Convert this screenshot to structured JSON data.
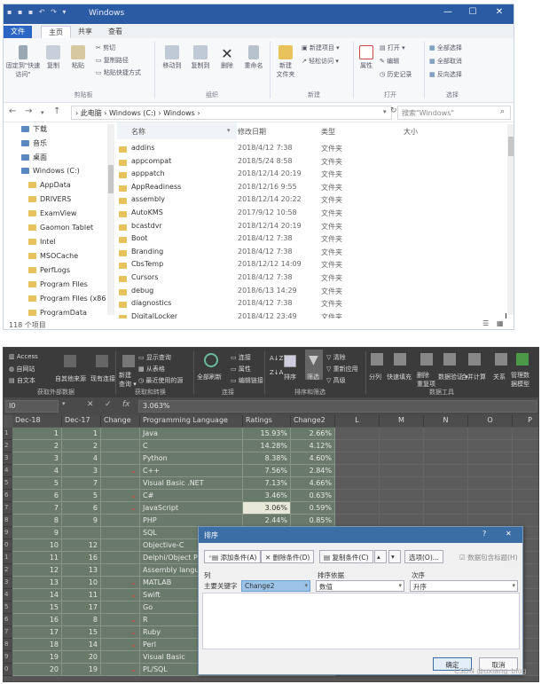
{
  "explorer": {
    "title": "Windows",
    "window_buttons": [
      "—",
      "☐",
      "✕"
    ],
    "tabs": [
      {
        "label": "文件",
        "type": "file"
      },
      {
        "label": "主页",
        "type": "active"
      },
      {
        "label": "共享",
        "type": "normal"
      },
      {
        "label": "查看",
        "type": "normal"
      }
    ],
    "ribbon": {
      "pin_label": "固定到\"快速访问\"",
      "copy_label": "复制",
      "paste_label": "粘贴",
      "cut_label": "剪切",
      "copy_path_label": "复制路径",
      "paste_shortcut_label": "粘贴快捷方式",
      "clipboard_group": "剪贴板",
      "move_to_label": "移动到",
      "copy_to_label": "复制到",
      "delete_label": "删除",
      "rename_label": "重命名",
      "organize_group": "组织",
      "new_item_label": "新建项目 ▾",
      "easy_access_label": "轻松访问 ▾",
      "new_folder_label": "新建\n文件夹",
      "new_group": "新建",
      "properties_label": "属性",
      "open_label": "打开 ▾",
      "edit_label": "编辑",
      "history_label": "历史记录",
      "open_group": "打开",
      "select_all_label": "全部选择",
      "select_none_label": "全部取消",
      "invert_label": "反向选择",
      "select_group": "选择"
    },
    "address": {
      "path": "›  此电脑  ›  Windows (C:)  ›  Windows  ›",
      "search_placeholder": "搜索\"Windows\""
    },
    "nav": [
      {
        "label": "下载",
        "indent": 0
      },
      {
        "label": "音乐",
        "indent": 0
      },
      {
        "label": "桌面",
        "indent": 0
      },
      {
        "label": "Windows (C:)",
        "indent": 0
      },
      {
        "label": "AppData",
        "indent": 1
      },
      {
        "label": "DRIVERS",
        "indent": 1
      },
      {
        "label": "ExamView",
        "indent": 1
      },
      {
        "label": "Gaomon Tablet",
        "indent": 1
      },
      {
        "label": "Intel",
        "indent": 1
      },
      {
        "label": "MSOCache",
        "indent": 1
      },
      {
        "label": "PerfLogs",
        "indent": 1
      },
      {
        "label": "Program Files",
        "indent": 1
      },
      {
        "label": "Program Files (x86",
        "indent": 1
      },
      {
        "label": "ProgramData",
        "indent": 1
      }
    ],
    "columns": {
      "name": "名称",
      "date": "修改日期",
      "type": "类型",
      "size": "大小"
    },
    "files": [
      {
        "name": "addins",
        "date": "2018/4/12 7:38",
        "type": "文件夹"
      },
      {
        "name": "appcompat",
        "date": "2018/5/24 8:58",
        "type": "文件夹"
      },
      {
        "name": "apppatch",
        "date": "2018/12/14 20:19",
        "type": "文件夹"
      },
      {
        "name": "AppReadiness",
        "date": "2018/12/16 9:55",
        "type": "文件夹"
      },
      {
        "name": "assembly",
        "date": "2018/12/14 20:22",
        "type": "文件夹"
      },
      {
        "name": "AutoKMS",
        "date": "2017/9/12 10:58",
        "type": "文件夹"
      },
      {
        "name": "bcastdvr",
        "date": "2018/12/14 20:19",
        "type": "文件夹"
      },
      {
        "name": "Boot",
        "date": "2018/4/12 7:38",
        "type": "文件夹"
      },
      {
        "name": "Branding",
        "date": "2018/4/12 7:38",
        "type": "文件夹"
      },
      {
        "name": "CbsTemp",
        "date": "2018/12/12 14:09",
        "type": "文件夹"
      },
      {
        "name": "Cursors",
        "date": "2018/4/12 7:38",
        "type": "文件夹"
      },
      {
        "name": "debug",
        "date": "2018/6/13 14:29",
        "type": "文件夹"
      },
      {
        "name": "diagnostics",
        "date": "2018/4/12 7:38",
        "type": "文件夹"
      },
      {
        "name": "DigitalLocker",
        "date": "2018/4/12 23:49",
        "type": "文件夹"
      }
    ],
    "status": "118 个项目"
  },
  "excel": {
    "ribbon": {
      "access": "Access",
      "from_web": "自网站",
      "from_text": "自文本",
      "other_sources": "自其他来源",
      "existing_conn": "现有连接",
      "get_external": "获取外部数据",
      "new_query": "新建\n查询 ▾",
      "show_queries": "显示查询",
      "from_table": "从表格",
      "recent_sources": "最近使用的源",
      "get_transform": "获取和转换",
      "refresh_all": "全部刷新",
      "connections": "连接",
      "properties": "属性",
      "edit_links": "编辑链接",
      "conn_group": "连接",
      "sort_az": "A↓Z",
      "sort_za": "Z↓A",
      "sort": "排序",
      "filter": "筛选",
      "clear": "清除",
      "reapply": "重新应用",
      "advanced": "高级",
      "sort_filter_group": "排序和筛选",
      "split": "分列",
      "flash_fill": "快速填充",
      "remove_dup": "删除\n重复项",
      "validate": "数据验证 ▾",
      "consolidate": "合并计算",
      "relations": "关系",
      "manage_model": "管理数\n据模型",
      "data_tools_group": "数据工具"
    },
    "name_box": "I0",
    "formula_value": "3.063%",
    "columns": [
      "Dec-18",
      "Dec-17",
      "Change",
      "Programming Language",
      "Ratings",
      "Change2",
      "L",
      "M",
      "N",
      "O",
      "P"
    ],
    "row_headers": [
      "1",
      "2",
      "3",
      "4",
      "5",
      "6",
      "7",
      "8",
      "9",
      "0",
      "1",
      "2",
      "3",
      "4",
      "5",
      "6",
      "7",
      "8",
      "9",
      "0",
      "1"
    ],
    "rows": [
      {
        "dec18": "1",
        "dec17": "1",
        "change": "",
        "lang": "Java",
        "rating": "15.93%",
        "change2": "2.66%"
      },
      {
        "dec18": "2",
        "dec17": "2",
        "change": "",
        "lang": "C",
        "rating": "14.28%",
        "change2": "4.12%"
      },
      {
        "dec18": "3",
        "dec17": "4",
        "change": "",
        "lang": "Python",
        "rating": "8.38%",
        "change2": "4.60%"
      },
      {
        "dec18": "4",
        "dec17": "3",
        "change": "⌄",
        "lang": "C++",
        "rating": "7.56%",
        "change2": "2.84%"
      },
      {
        "dec18": "5",
        "dec17": "7",
        "change": "",
        "lang": "Visual Basic .NET",
        "rating": "7.13%",
        "change2": "4.66%"
      },
      {
        "dec18": "6",
        "dec17": "5",
        "change": "⌄",
        "lang": "C#",
        "rating": "3.46%",
        "change2": "0.63%"
      },
      {
        "dec18": "7",
        "dec17": "6",
        "change": "⌄",
        "lang": "JavaScript",
        "rating": "3.06%",
        "change2": "0.59%"
      },
      {
        "dec18": "8",
        "dec17": "9",
        "change": "",
        "lang": "PHP",
        "rating": "2.44%",
        "change2": "0.85%"
      },
      {
        "dec18": "9",
        "dec17": "",
        "change": "",
        "lang": "SQL",
        "rating": "",
        "change2": ""
      },
      {
        "dec18": "10",
        "dec17": "12",
        "change": "",
        "lang": "Objective-C",
        "rating": "",
        "change2": ""
      },
      {
        "dec18": "11",
        "dec17": "16",
        "change": "",
        "lang": "Delphi/Object P",
        "rating": "",
        "change2": ""
      },
      {
        "dec18": "12",
        "dec17": "13",
        "change": "",
        "lang": "Assembly langu",
        "rating": "",
        "change2": ""
      },
      {
        "dec18": "13",
        "dec17": "10",
        "change": "⌄",
        "lang": "MATLAB",
        "rating": "",
        "change2": ""
      },
      {
        "dec18": "14",
        "dec17": "11",
        "change": "⌄",
        "lang": "Swift",
        "rating": "",
        "change2": ""
      },
      {
        "dec18": "15",
        "dec17": "17",
        "change": "",
        "lang": "Go",
        "rating": "",
        "change2": ""
      },
      {
        "dec18": "16",
        "dec17": "8",
        "change": "⌄",
        "lang": "R",
        "rating": "",
        "change2": ""
      },
      {
        "dec18": "17",
        "dec17": "15",
        "change": "⌄",
        "lang": "Ruby",
        "rating": "",
        "change2": ""
      },
      {
        "dec18": "18",
        "dec17": "14",
        "change": "⌄",
        "lang": "Perl",
        "rating": "",
        "change2": ""
      },
      {
        "dec18": "19",
        "dec17": "20",
        "change": "",
        "lang": "Visual Basic",
        "rating": "",
        "change2": ""
      },
      {
        "dec18": "20",
        "dec17": "19",
        "change": "⌄",
        "lang": "PL/SQL",
        "rating": "",
        "change2": ""
      }
    ]
  },
  "sort_dialog": {
    "title": "排序",
    "help": "?",
    "close": "✕",
    "add_level": "添加条件(A)",
    "delete_level": "删除条件(D)",
    "copy_level": "复制条件(C)",
    "options": "选项(O)...",
    "has_headers": "数据包含标题(H)",
    "col_header": "列",
    "sort_on_header": "排序依据",
    "order_header": "次序",
    "main_key_label": "主要关键字",
    "main_key_value": "Change2",
    "sort_on_value": "数值",
    "order_value": "升序",
    "ok": "确定",
    "cancel": "取消"
  },
  "watermark": "CSDN @uxiang_blog"
}
